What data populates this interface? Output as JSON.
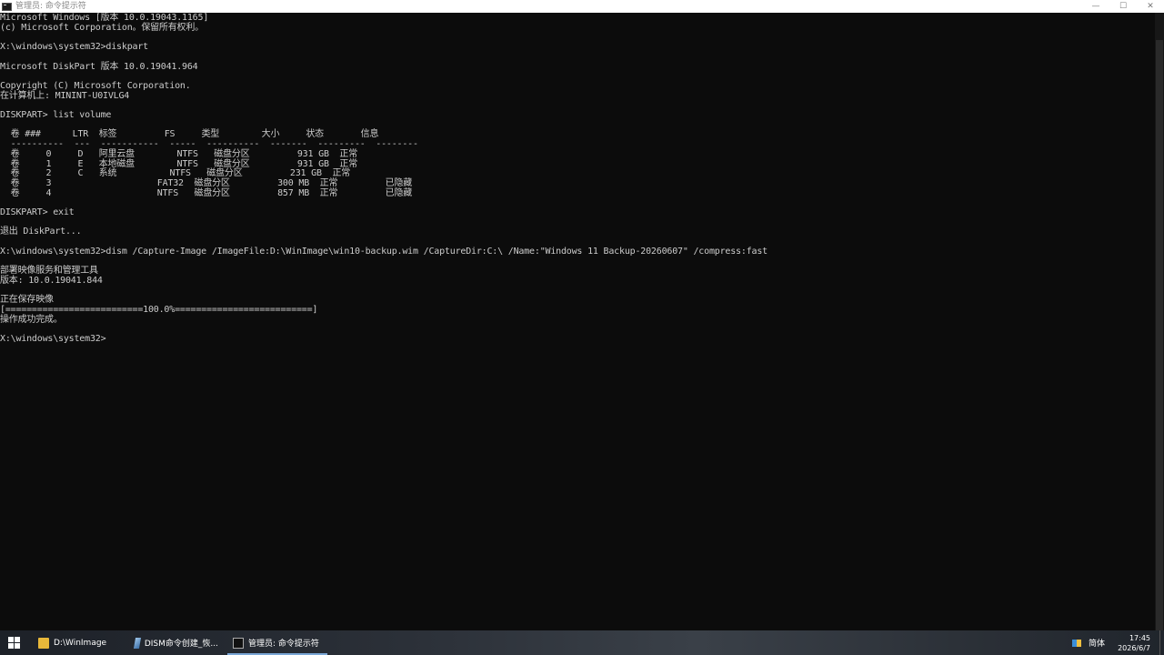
{
  "window": {
    "title": "管理员: 命令提示符",
    "minimize_label": "—",
    "maximize_label": "☐",
    "close_label": "✕"
  },
  "console": {
    "lines": [
      "Microsoft Windows [版本 10.0.19043.1165]",
      "(c) Microsoft Corporation。保留所有权利。",
      "",
      "X:\\windows\\system32>diskpart",
      "",
      "Microsoft DiskPart 版本 10.0.19041.964",
      "",
      "Copyright (C) Microsoft Corporation.",
      "在计算机上: MININT-U0IVLG4",
      "",
      "DISKPART> list volume",
      "",
      "  卷 ###      LTR  标签         FS     类型        大小     状态       信息",
      "  ----------  ---  -----------  -----  ----------  -------  ---------  --------",
      "  卷     0     D   阿里云盘        NTFS   磁盘分区         931 GB  正常",
      "  卷     1     E   本地磁盘        NTFS   磁盘分区         931 GB  正常",
      "  卷     2     C   系统          NTFS   磁盘分区         231 GB  正常",
      "  卷     3                    FAT32  磁盘分区         300 MB  正常         已隐藏",
      "  卷     4                    NTFS   磁盘分区         857 MB  正常         已隐藏",
      "",
      "DISKPART> exit",
      "",
      "退出 DiskPart...",
      "",
      "X:\\windows\\system32>dism /Capture-Image /ImageFile:D:\\WinImage\\win10-backup.wim /CaptureDir:C:\\ /Name:\"Windows 11 Backup-20260607\" /compress:fast",
      "",
      "部署映像服务和管理工具",
      "版本: 10.0.19041.844",
      "",
      "正在保存映像",
      "[==========================100.0%==========================]",
      "操作成功完成。",
      "",
      "X:\\windows\\system32>"
    ]
  },
  "taskbar": {
    "start_label": "Start",
    "items": [
      {
        "label": "D:\\WinImage",
        "icon": "folder-icon"
      },
      {
        "label": "DISM命令创建_恢...",
        "icon": "dism-icon"
      },
      {
        "label": "管理员: 命令提示符",
        "icon": "cmd-icon"
      }
    ],
    "ime": "简体",
    "time": "17:45",
    "date": "2026/6/7"
  }
}
